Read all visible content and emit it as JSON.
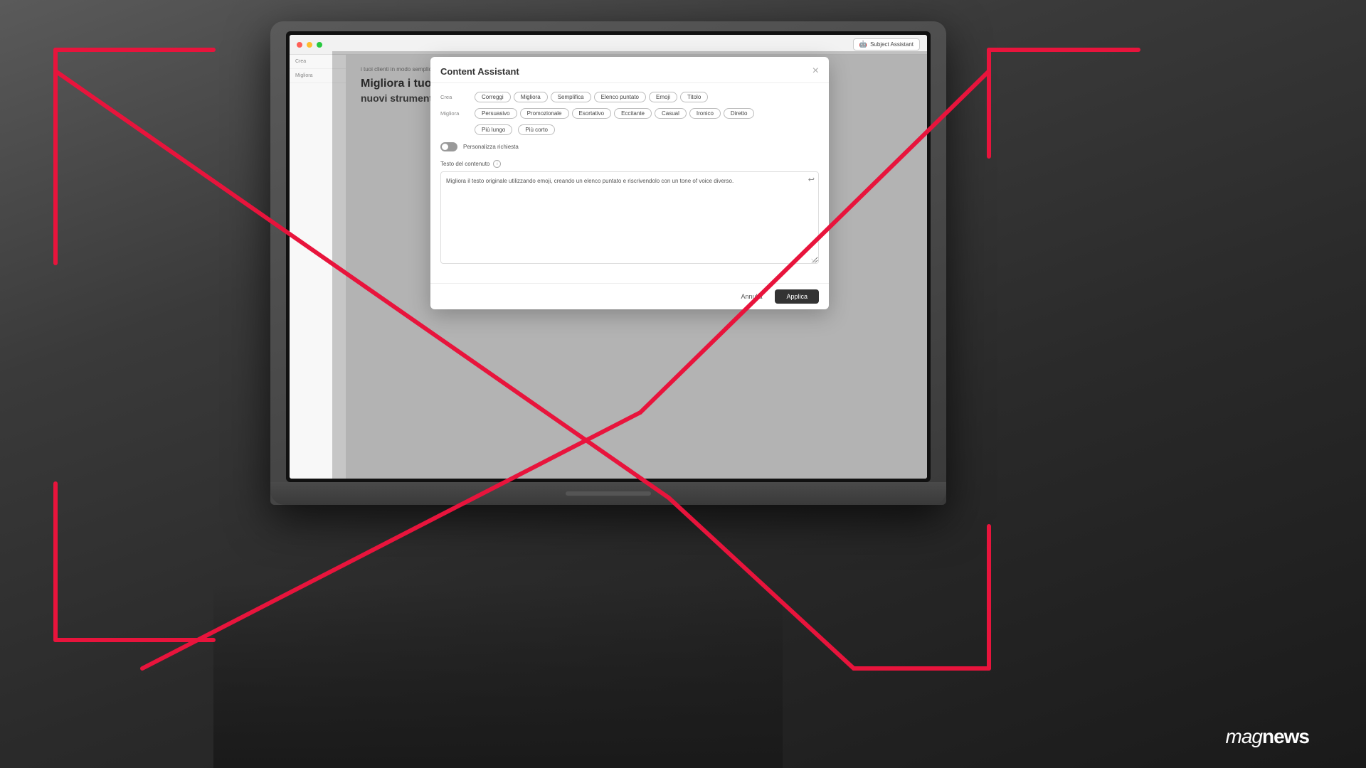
{
  "app": {
    "title": "Content Assistant"
  },
  "header": {
    "subject_assistant_label": "Subject Assistant",
    "close_label": "×"
  },
  "modal": {
    "title": "Content Assistant",
    "row1": {
      "label": "Crea",
      "tags": [
        "Correggi",
        "Migliora",
        "Semplifica",
        "Elenco puntato",
        "Emoji",
        "Titolo"
      ]
    },
    "row2": {
      "label": "Migliora",
      "tags": [
        "Persuasivo",
        "Promozionale",
        "Esortativo",
        "Eccitante",
        "Casual",
        "Ironico",
        "Diretto"
      ]
    },
    "row3": {
      "tags": [
        "Più lungo",
        "Più corto"
      ]
    },
    "personalizza": {
      "label": "Personalizza richiesta",
      "toggle_on": false
    },
    "content_field": {
      "label": "Testo del contenuto",
      "info": "i",
      "placeholder": "Migliora il testo originale utilizzando emoji, creando un elenco puntato e riscrivendolo con un tone of voice diverso."
    },
    "footer": {
      "cancel_label": "Annulla",
      "apply_label": "Applica"
    }
  },
  "background_text": {
    "small": "i tuoi clienti in modo semplice e veloce.",
    "heading1": "Migliora i tuoi contenuti con i",
    "heading2": "nuovi strumenti di Content Assistant"
  },
  "logo": {
    "mag": "mag",
    "news": "news"
  },
  "sidebar": {
    "items": [
      {
        "label": "Crea"
      },
      {
        "label": "Migliora"
      }
    ]
  }
}
